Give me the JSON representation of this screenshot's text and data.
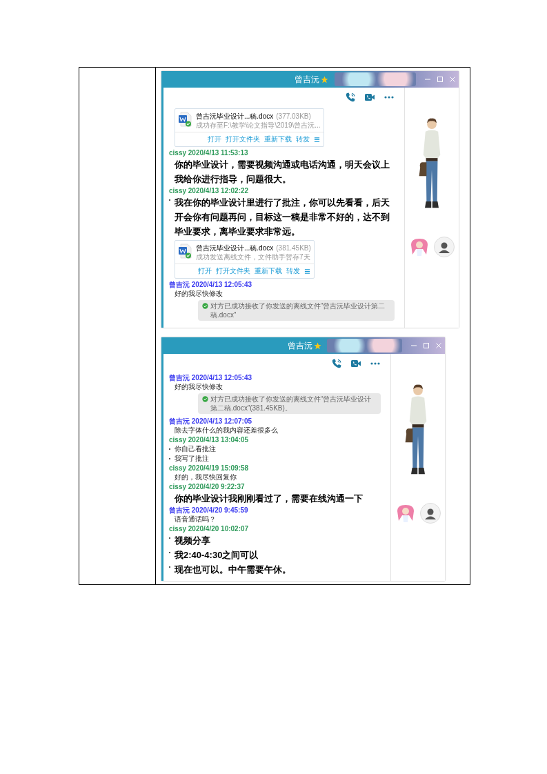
{
  "windows": [
    {
      "title": "曾吉沅",
      "messages": [
        {
          "kind": "file",
          "name": "曾吉沅毕业设计...稿.docx",
          "size": "(377.03KB)",
          "status": "成功存至F:\\教学\\论文指导\\2019\\曾吉沅...",
          "actions": [
            "打开",
            "打开文件夹",
            "重新下载",
            "转发"
          ]
        },
        {
          "kind": "header",
          "sender": "cissy",
          "time": "2020/4/13 11:53:13",
          "color": "#2e9a5a"
        },
        {
          "kind": "text",
          "text": "你的毕业设计，需要视频沟通或电话沟通，明天会议上我给你进行指导，问题很大。",
          "large": true,
          "bullet": false
        },
        {
          "kind": "header",
          "sender": "cissy",
          "time": "2020/4/13 12:02:22",
          "color": "#2e9a5a"
        },
        {
          "kind": "text",
          "text": "我在你的毕业设计里进行了批注，你可以先看看，后天开会你有问题再问，目标这一稿是非常不好的，达不到毕业要求，离毕业要求非常远。",
          "large": true,
          "bullet": true
        },
        {
          "kind": "file",
          "name": "曾吉沅毕业设计...稿.docx",
          "size": "(381.45KB)",
          "status": "成功发送离线文件，文件助手暂存7天",
          "actions": [
            "打开",
            "打开文件夹",
            "重新下载",
            "转发"
          ]
        },
        {
          "kind": "header",
          "sender": "曾吉沅",
          "time": "2020/4/13 12:05:43",
          "color": "#3b3bf0"
        },
        {
          "kind": "text",
          "text": "好的我尽快修改",
          "large": false,
          "bullet": false
        },
        {
          "kind": "notice",
          "text": "对方已成功接收了你发送的离线文件“曾吉沅毕业设计第二稿.docx”"
        }
      ]
    },
    {
      "title": "曾吉沅",
      "messages": [
        {
          "kind": "header",
          "sender": "曾吉沅",
          "time": "2020/4/13 12:05:43",
          "color": "#3b3bf0"
        },
        {
          "kind": "text",
          "text": "好的我尽快修改",
          "large": false,
          "bullet": false
        },
        {
          "kind": "notice",
          "text": "对方已成功接收了你发送的离线文件“曾吉沅毕业设计第二稿.docx”(381.45KB)。"
        },
        {
          "kind": "header",
          "sender": "曾吉沅",
          "time": "2020/4/13 12:07:05",
          "color": "#3b3bf0"
        },
        {
          "kind": "text",
          "text": "除去字体什么的我内容还差很多么",
          "large": false,
          "bullet": false
        },
        {
          "kind": "header",
          "sender": "cissy",
          "time": "2020/4/13 13:04:05",
          "color": "#2e9a5a"
        },
        {
          "kind": "text",
          "text": "你自己看批注",
          "large": false,
          "bullet": true
        },
        {
          "kind": "text",
          "text": "我写了批注",
          "large": false,
          "bullet": true
        },
        {
          "kind": "header",
          "sender": "cissy",
          "time": "2020/4/19 15:09:58",
          "color": "#2e9a5a"
        },
        {
          "kind": "text",
          "text": "好的，我尽快回复你",
          "large": false,
          "bullet": false
        },
        {
          "kind": "header",
          "sender": "cissy",
          "time": "2020/4/20 9:22:37",
          "color": "#2e9a5a"
        },
        {
          "kind": "text",
          "text": "你的毕业设计我刚刚看过了，需要在线沟通一下",
          "large": true,
          "bullet": false
        },
        {
          "kind": "header",
          "sender": "曾吉沅",
          "time": "2020/4/20 9:45:59",
          "color": "#3b3bf0"
        },
        {
          "kind": "text",
          "text": "语音通话吗？",
          "large": false,
          "bullet": false
        },
        {
          "kind": "header",
          "sender": "cissy",
          "time": "2020/4/20 10:02:07",
          "color": "#2e9a5a"
        },
        {
          "kind": "text",
          "text": "视频分享",
          "large": true,
          "bullet": true
        },
        {
          "kind": "text",
          "text": "我2:40-4:30之间可以",
          "large": true,
          "bullet": true
        },
        {
          "kind": "text",
          "text": "现在也可以。中午需要午休。",
          "large": true,
          "bullet": true
        }
      ]
    }
  ]
}
